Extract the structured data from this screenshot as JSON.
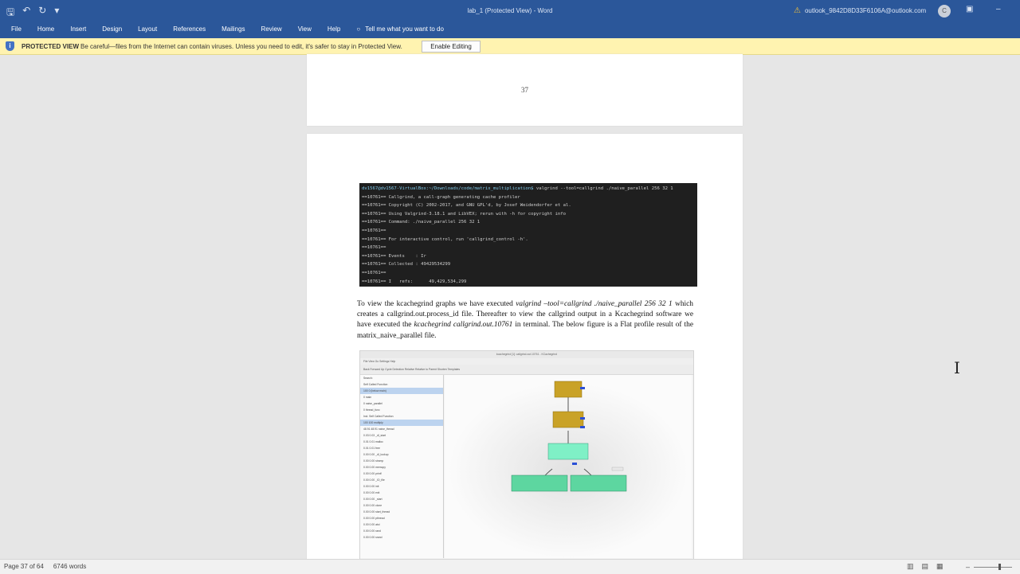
{
  "title_bar": {
    "doc_title": "lab_1 (Protected View) - Word",
    "account": "outlook_9842D8D33F6106A@outlook.com",
    "avatar_initial": "C"
  },
  "ribbon": {
    "tabs": [
      "File",
      "Home",
      "Insert",
      "Design",
      "Layout",
      "References",
      "Mailings",
      "Review",
      "View",
      "Help"
    ],
    "tell_me": "Tell me what you want to do"
  },
  "protected_view": {
    "label": "PROTECTED VIEW",
    "message": "Be careful—files from the Internet can contain viruses. Unless you need to edit, it's safer to stay in Protected View.",
    "button": "Enable Editing"
  },
  "document": {
    "page_number": "37",
    "terminal": {
      "prompt_path": "dv1567@dv1567-VirtualBox:~/Downloads/code/matrix_multiplication$",
      "prompt_cmd": " valgrind --tool=callgrind ./naive_parallel 256 32 1",
      "lines": [
        "==10761== Callgrind, a call-graph generating cache profiler",
        "==10761== Copyright (C) 2002-2017, and GNU GPL'd, by Josef Weidendorfer et al.",
        "==10761== Using Valgrind-3.18.1 and LibVEX; rerun with -h for copyright info",
        "==10761== Command: ./naive_parallel 256 32 1",
        "==10761==",
        "==10761== For interactive control, run 'callgrind_control -h'.",
        "==10761==",
        "==10761== Events    : Ir",
        "==10761== Collected : 49429534299",
        "==10761==",
        "==10761== I   refs:      49,429,534,299"
      ]
    },
    "paragraph": {
      "p1": "To view the kcachegrind graphs we have executed ",
      "cmd1": "valgrind –tool=callgrind ./naive_parallel 256 32 1",
      "p2": " which creates a  callgrind.out.process_id file. Thereafter to view the callgrind output in a Kcachegrind software we have executed the ",
      "cmd2": "kcachegrind callgrind.out.10761",
      "p3": " in terminal. The below figure is a Flat profile result of the matrix_naive_parallel file."
    },
    "embedded_screenshot": {
      "window_title": "kcachegrind [1]: callgrind.out.10761 - KCachegrind",
      "menu": "File  View  Go  Settings  Help",
      "toolbar": "Back  Forward  Up    Cycle Detection    Relative  Relative to Parent    Shorten Templates",
      "left_rows": [
        "Search:",
        "Self   Called   Function",
        "100  0  (below main)",
        "  0  main",
        "  0  naive_parallel",
        "  0  thread_func",
        "Incl.  Self  Called  Function",
        "100  100  multiply",
        "48.91  48.91  naive_thread",
        "  0.03  0.03  _dl_start",
        "  0.01  0.01  malloc",
        "  0.01  0.01  free",
        "  0.00  0.00  _dl_lookup",
        "  0.00  0.00  strcmp",
        "  0.00  0.00  memcpy",
        "  0.00  0.00  printf",
        "  0.00  0.00  _IO_file",
        "  0.00  0.00  init",
        "  0.00  0.00  exit",
        "  0.00  0.00  _start",
        "  0.00  0.00  clone",
        "  0.00  0.00  start_thread",
        "  0.00  0.00  pthread",
        "  0.00  0.00  atoi",
        "  0.00  0.00  rand",
        "  0.00  0.00  srand"
      ]
    }
  },
  "status_bar": {
    "page": "Page 37 of 64",
    "words": "6746 words"
  },
  "colors": {
    "word_blue": "#2b579a",
    "protected_yellow": "#fff3b0"
  }
}
